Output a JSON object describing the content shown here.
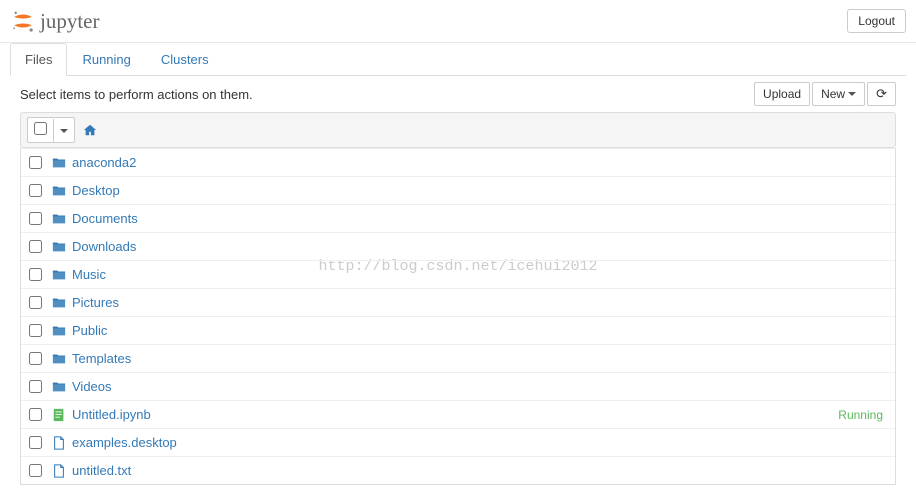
{
  "header": {
    "brand": "jupyter",
    "logout": "Logout"
  },
  "tabs": {
    "files": "Files",
    "running": "Running",
    "clusters": "Clusters"
  },
  "toolbar": {
    "hint": "Select items to perform actions on them.",
    "upload": "Upload",
    "new": "New"
  },
  "items": [
    {
      "name": "anaconda2",
      "type": "folder"
    },
    {
      "name": "Desktop",
      "type": "folder"
    },
    {
      "name": "Documents",
      "type": "folder"
    },
    {
      "name": "Downloads",
      "type": "folder"
    },
    {
      "name": "Music",
      "type": "folder"
    },
    {
      "name": "Pictures",
      "type": "folder"
    },
    {
      "name": "Public",
      "type": "folder"
    },
    {
      "name": "Templates",
      "type": "folder"
    },
    {
      "name": "Videos",
      "type": "folder"
    },
    {
      "name": "Untitled.ipynb",
      "type": "notebook",
      "status": "Running"
    },
    {
      "name": "examples.desktop",
      "type": "file"
    },
    {
      "name": "untitled.txt",
      "type": "file"
    }
  ],
  "watermark": "http://blog.csdn.net/icehui2012"
}
